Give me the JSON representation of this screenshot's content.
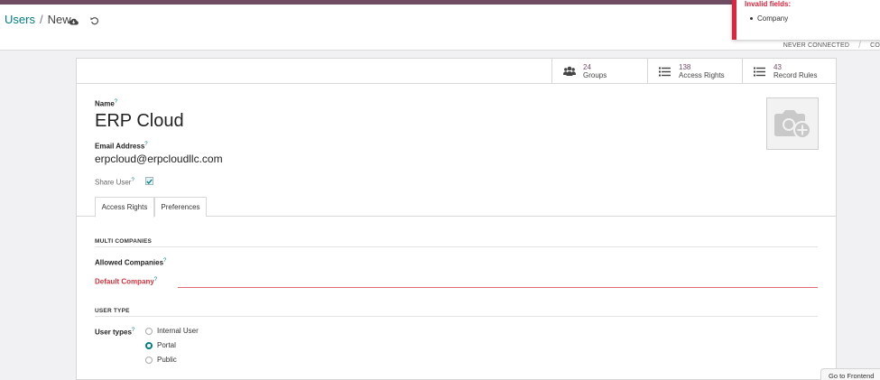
{
  "breadcrumb": {
    "parent": "Users",
    "current": "New"
  },
  "toast": {
    "title": "Invalid fields:",
    "items": [
      "Company"
    ]
  },
  "status_bar": {
    "stages": [
      "NEVER CONNECTED",
      "CO"
    ]
  },
  "stat_buttons": [
    {
      "value": "24",
      "label": "Groups",
      "icon": "users-icon"
    },
    {
      "value": "138",
      "label": "Access Rights",
      "icon": "list-icon"
    },
    {
      "value": "43",
      "label": "Record Rules",
      "icon": "list-icon"
    }
  ],
  "form": {
    "name_label": "Name",
    "name_value": "ERP Cloud",
    "email_label": "Email Address",
    "email_value": "erpcloud@erpcloudllc.com",
    "share_label": "Share User",
    "share_checked": true,
    "help_mark": "?"
  },
  "tabs": [
    {
      "label": "Access Rights",
      "active": true
    },
    {
      "label": "Preferences",
      "active": false
    }
  ],
  "multi_companies": {
    "title": "MULTI COMPANIES",
    "allowed_label": "Allowed Companies",
    "default_label": "Default Company"
  },
  "user_type": {
    "title": "USER TYPE",
    "label": "User types",
    "options": [
      {
        "label": "Internal User",
        "selected": false
      },
      {
        "label": "Portal",
        "selected": true
      },
      {
        "label": "Public",
        "selected": false
      }
    ]
  },
  "footer": {
    "frontend_button": "Go to Frontend"
  },
  "colors": {
    "accent": "#017e84",
    "brand": "#714b67",
    "error": "#e0243b"
  }
}
